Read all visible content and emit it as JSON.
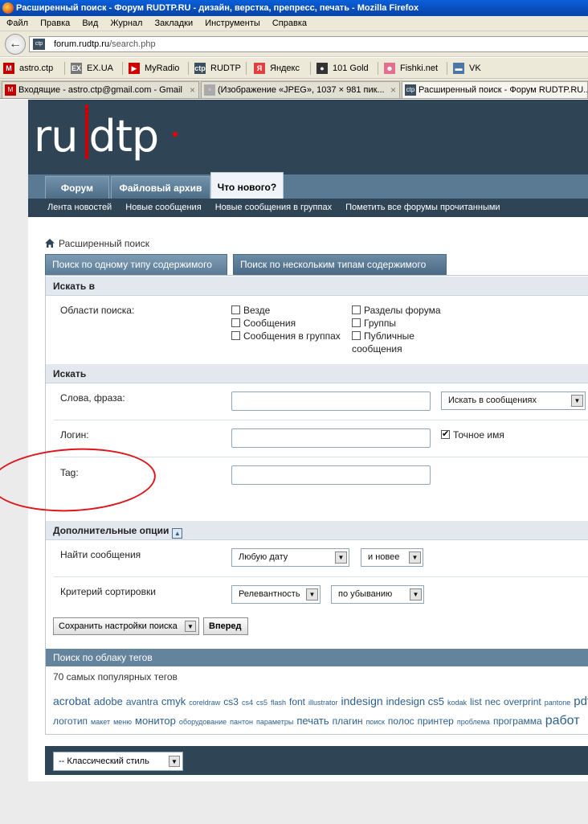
{
  "window": {
    "title": "Расширенный поиск - Форум RUDTP.RU - дизайн, верстка, препресс, печать - Mozilla Firefox"
  },
  "menu": [
    "Файл",
    "Правка",
    "Вид",
    "Журнал",
    "Закладки",
    "Инструменты",
    "Справка"
  ],
  "url": {
    "domain": "forum.rudtp.ru",
    "path": "/search.php",
    "favicon": "ctp"
  },
  "bookmarks": [
    {
      "label": "astro.ctp",
      "icon": "gmail-icon",
      "icon_char": "M",
      "color": "#c00000"
    },
    {
      "label": "EX.UA",
      "icon": "exua-icon",
      "icon_char": "EX",
      "color": "#777777"
    },
    {
      "label": "MyRadio",
      "icon": "play-icon",
      "icon_char": "▶",
      "color": "#cc0000"
    },
    {
      "label": "RUDTP",
      "icon": "rudtp-icon",
      "icon_char": "ctp",
      "color": "#3a5060"
    },
    {
      "label": "Яндекс",
      "icon": "yandex-icon",
      "icon_char": "Я",
      "color": "#e04040"
    },
    {
      "label": "101 Gold",
      "icon": "radio-icon",
      "icon_char": "●",
      "color": "#333333"
    },
    {
      "label": "Fishki.net",
      "icon": "pig-icon",
      "icon_char": "☻",
      "color": "#e07090"
    },
    {
      "label": "VK",
      "icon": "vk-icon",
      "icon_char": "▬",
      "color": "#4a76a8"
    }
  ],
  "tabs": [
    {
      "label": "Входящие - astro.ctp@gmail.com - Gmail",
      "icon_char": "M",
      "color": "#c00000"
    },
    {
      "label": "(Изображение «JPEG», 1037 × 981 пик...",
      "icon_char": "▫",
      "color": "#aaaaaa"
    },
    {
      "label": "Расширенный поиск - Форум RUDTP.RU...",
      "icon_char": "ctp",
      "color": "#3a5060"
    }
  ],
  "site": {
    "logo_left": "ru",
    "logo_right": "dtp",
    "nav_tabs": [
      "Форум",
      "Файловый архив",
      "Что нового?"
    ],
    "subnav": [
      "Лента новостей",
      "Новые сообщения",
      "Новые сообщения в группах",
      "Пометить все форумы прочитанными"
    ]
  },
  "breadcrumb": "Расширенный поиск",
  "search_tabs": [
    "Поиск по одному типу содержимого",
    "Поиск по нескольким типам содержимого"
  ],
  "section_search_in": {
    "title": "Искать в",
    "label": "Области поиска:",
    "options": [
      "Везде",
      "Сообщения",
      "Сообщения в группах",
      "Разделы форума",
      "Группы",
      "Публичные",
      "сообщения"
    ]
  },
  "section_search": {
    "title": "Искать",
    "words_label": "Слова, фраза:",
    "words_value": "",
    "words_scope": "Искать в сообщениях",
    "login_label": "Логин:",
    "login_value": "",
    "exact_name": "Точное имя",
    "exact_name_checked": true,
    "tag_label": "Tag:",
    "tag_value": ""
  },
  "section_extra": {
    "title": "Дополнительные опции",
    "find_label": "Найти сообщения",
    "date_value": "Любую дату",
    "newer_value": "и новее",
    "sort_label": "Критерий сортировки",
    "sort_value": "Релевантность",
    "order_value": "по убыванию",
    "save_button": "Сохранить настройки поиска",
    "submit_button": "Вперед"
  },
  "tag_cloud": {
    "title": "Поиск по облаку тегов",
    "count_text": "70 самых популярных тегов",
    "line1": [
      {
        "t": "acrobat",
        "s": 14
      },
      {
        "t": "adobe",
        "s": 13
      },
      {
        "t": "avantra",
        "s": 12
      },
      {
        "t": "cmyk",
        "s": 13
      },
      {
        "t": "coreldraw",
        "s": 9
      },
      {
        "t": "cs3",
        "s": 12
      },
      {
        "t": "cs4",
        "s": 9
      },
      {
        "t": "cs5",
        "s": 9
      },
      {
        "t": "flash",
        "s": 9
      },
      {
        "t": "font",
        "s": 12
      },
      {
        "t": "illustrator",
        "s": 9
      },
      {
        "t": "indesign",
        "s": 14
      },
      {
        "t": "indesign cs5",
        "s": 13
      },
      {
        "t": "kodak",
        "s": 9
      },
      {
        "t": "list",
        "s": 12
      },
      {
        "t": "nec",
        "s": 12
      },
      {
        "t": "overprint",
        "s": 12
      },
      {
        "t": "pantone",
        "s": 9
      },
      {
        "t": "pdf",
        "s": 15
      }
    ],
    "line2": [
      {
        "t": "логотип",
        "s": 12
      },
      {
        "t": "макет",
        "s": 9
      },
      {
        "t": "меню",
        "s": 9
      },
      {
        "t": "монитор",
        "s": 13
      },
      {
        "t": "оборудование",
        "s": 9
      },
      {
        "t": "пантон",
        "s": 9
      },
      {
        "t": "параметры",
        "s": 9
      },
      {
        "t": "печать",
        "s": 13
      },
      {
        "t": "плагин",
        "s": 12
      },
      {
        "t": "поиск",
        "s": 9
      },
      {
        "t": "полос",
        "s": 12
      },
      {
        "t": "принтер",
        "s": 12
      },
      {
        "t": "проблема",
        "s": 9
      },
      {
        "t": "программа",
        "s": 12
      },
      {
        "t": "работ",
        "s": 16
      }
    ]
  },
  "footer": {
    "style_select": "-- Классический стиль"
  },
  "colors": {
    "header": "#2f4455",
    "accent_red": "#e0141a",
    "link": "#2d5f8f"
  }
}
